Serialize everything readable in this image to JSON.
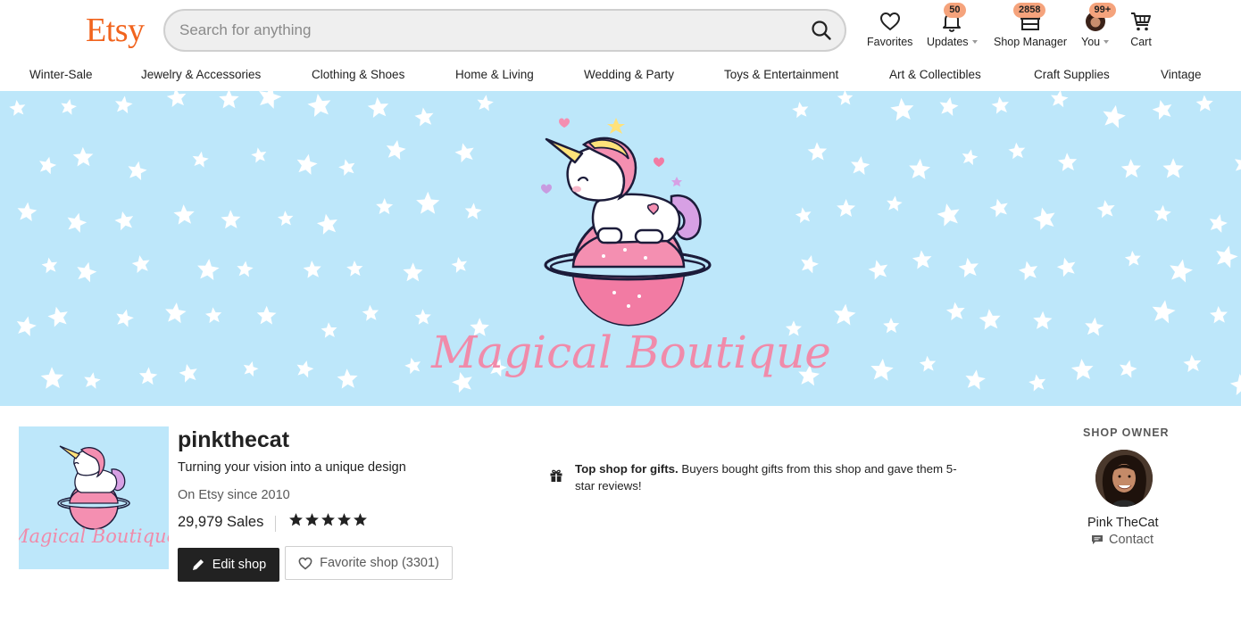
{
  "header": {
    "logo": "Etsy",
    "search": {
      "placeholder": "Search for anything",
      "value": ""
    },
    "nav": {
      "favorites": {
        "label": "Favorites"
      },
      "updates": {
        "label": "Updates",
        "badge": "50"
      },
      "shop_manager": {
        "label": "Shop Manager",
        "badge": "2858"
      },
      "you": {
        "label": "You",
        "badge": "99+"
      },
      "cart": {
        "label": "Cart"
      }
    }
  },
  "categories": [
    "Winter-Sale",
    "Jewelry & Accessories",
    "Clothing & Shoes",
    "Home & Living",
    "Wedding & Party",
    "Toys & Entertainment",
    "Art & Collectibles",
    "Craft Supplies",
    "Vintage"
  ],
  "banner": {
    "brand_text": "Magical Boutique"
  },
  "shop": {
    "icon_text": "Magical Boutique",
    "name": "pinkthecat",
    "tagline": "Turning your vision into a unique design",
    "since": "On Etsy since 2010",
    "sales": "29,979 Sales",
    "rating_stars": 5,
    "edit_label": "Edit shop",
    "favorite_label": "Favorite shop (3301)"
  },
  "gift": {
    "bold": "Top shop for gifts.",
    "text": " Buyers bought gifts from this shop and gave them 5-star reviews!"
  },
  "owner": {
    "heading": "SHOP OWNER",
    "name": "Pink TheCat",
    "contact_label": "Contact"
  },
  "colors": {
    "brand": "#F1641E",
    "badge": "#F5A37C",
    "banner_bg": "#BDE7FA",
    "brand_pink": "#F08BAA"
  }
}
